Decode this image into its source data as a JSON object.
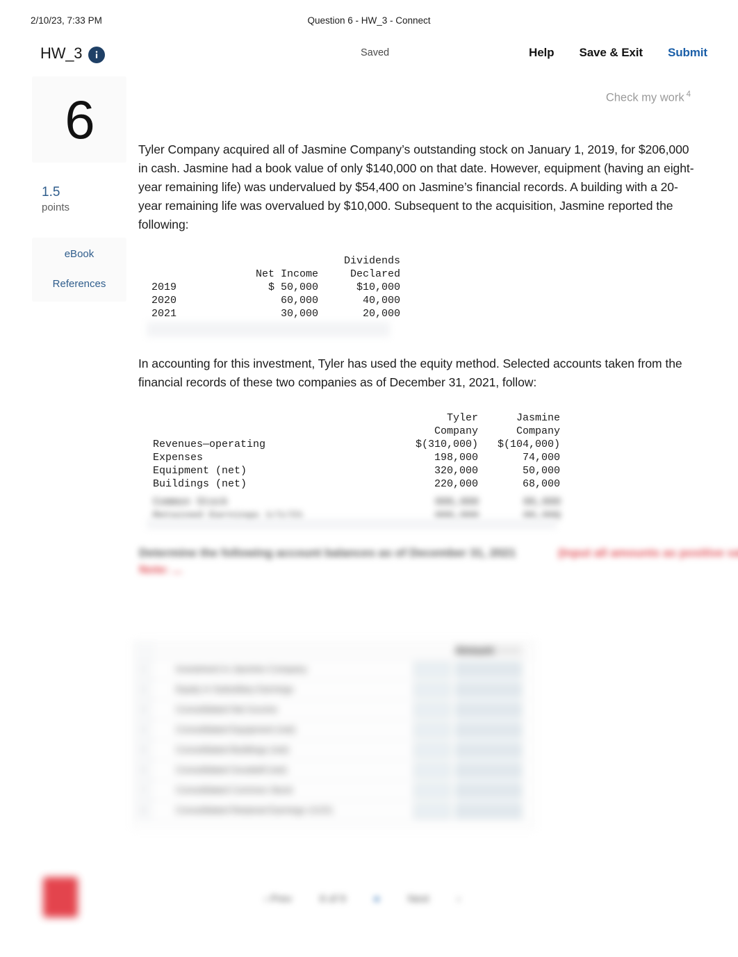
{
  "print_header": {
    "date": "2/10/23, 7:33 PM",
    "title": "Question 6 - HW_3 - Connect"
  },
  "toolbar": {
    "assignment_title": "HW_3",
    "info_icon": "info-icon",
    "saved_status": "Saved",
    "help_label": "Help",
    "save_exit_label": "Save & Exit",
    "submit_label": "Submit",
    "submit_color": "#1b5fa8"
  },
  "rail": {
    "question_number": "6",
    "points_value": "1.5",
    "points_label": "points",
    "ebook_label": "eBook",
    "references_label": "References",
    "link_color": "#2f5d8c"
  },
  "check_work": {
    "label": "Check my work",
    "superscript": "4"
  },
  "content": {
    "paragraph_1": "Tyler Company acquired all of Jasmine Company’s outstanding stock on January 1, 2019, for $206,000 in cash. Jasmine had a book value of only $140,000 on that date. However, equipment (having an eight-year remaining life) was undervalued by $54,400 on Jasmine’s financial records. A building with a 20-year remaining life was overvalued by $10,000. Subsequent to the acquisition, Jasmine reported the following:",
    "paragraph_2": "In accounting for this investment, Tyler has used the equity method. Selected accounts taken from the financial records of these two companies as of December 31, 2021, follow:"
  },
  "table_income": {
    "header_line1": [
      "",
      "",
      "Dividends"
    ],
    "headers": [
      "",
      "Net Income",
      "Declared"
    ],
    "rows": [
      {
        "year": "2019",
        "net_income": "$ 50,000",
        "dividends": "$10,000"
      },
      {
        "year": "2020",
        "net_income": "60,000",
        "dividends": "40,000"
      },
      {
        "year": "2021",
        "net_income": "30,000",
        "dividends": "20,000"
      }
    ]
  },
  "table_accounts": {
    "header_line1": [
      "",
      "Tyler",
      "Jasmine"
    ],
    "header_line2": [
      "",
      "Company",
      "Company"
    ],
    "rows": [
      {
        "label": "Revenues—operating",
        "tyler": "$(310,000)",
        "jasmine": "$(104,000)"
      },
      {
        "label": "Expenses",
        "tyler": "198,000",
        "jasmine": "74,000"
      },
      {
        "label": "Equipment (net)",
        "tyler": "320,000",
        "jasmine": "50,000"
      },
      {
        "label": "Buildings (net)",
        "tyler": "220,000",
        "jasmine": "68,000"
      }
    ]
  },
  "redacted": {
    "note": "obscured",
    "mono_row_a": "Common Stock",
    "mono_row_b": "Retained Earnings 1/1/21",
    "mono_val_a": "000,000",
    "mono_val_b": "000,000",
    "mono_val_c": "00,000",
    "mono_val_d": "00,000",
    "prompt_line": "Determine the following account balances as of December 31, 2021",
    "prompt_tail": "(Input all amounts as positive values.)",
    "prompt_sub": "Note: ...",
    "answer_rows": [
      {
        "idx": "1",
        "label": "Investment in Jasmine Company"
      },
      {
        "idx": "2",
        "label": "Equity in Subsidiary Earnings"
      },
      {
        "idx": "3",
        "label": "Consolidated Net Income"
      },
      {
        "idx": "4",
        "label": "Consolidated Equipment (net)"
      },
      {
        "idx": "5",
        "label": "Consolidated Buildings (net)"
      },
      {
        "idx": "6",
        "label": "Consolidated Goodwill (net)"
      },
      {
        "idx": "7",
        "label": "Consolidated Common Stock"
      },
      {
        "idx": "8",
        "label": "Consolidated Retained Earnings 1/1/21"
      }
    ],
    "answer_header": "Amount"
  },
  "footer": {
    "logo": "mcgraw-hill-logo",
    "pager_items": [
      "‹ Prev",
      "6 of 9",
      "●",
      "Next",
      "›"
    ]
  }
}
